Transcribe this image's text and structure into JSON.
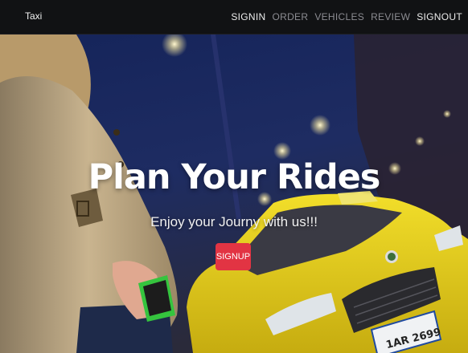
{
  "nav": {
    "brand": "Taxi",
    "links": [
      {
        "label": "SIGNIN",
        "active": true
      },
      {
        "label": "ORDER",
        "active": false
      },
      {
        "label": "VEHICLES",
        "active": false
      },
      {
        "label": "REVIEW",
        "active": false
      },
      {
        "label": "SIGNOUT",
        "active": true
      }
    ]
  },
  "hero": {
    "title": "Plan Your Rides",
    "subtitle": "Enjoy your Journy with us!!!",
    "button_label": "SIGNUP",
    "plate_text": "1AR 2699"
  },
  "colors": {
    "navbar_bg": "#111214",
    "button_bg": "#e23443",
    "taxi_yellow": "#e8d21a",
    "night_sky": "#1c2a5e"
  }
}
